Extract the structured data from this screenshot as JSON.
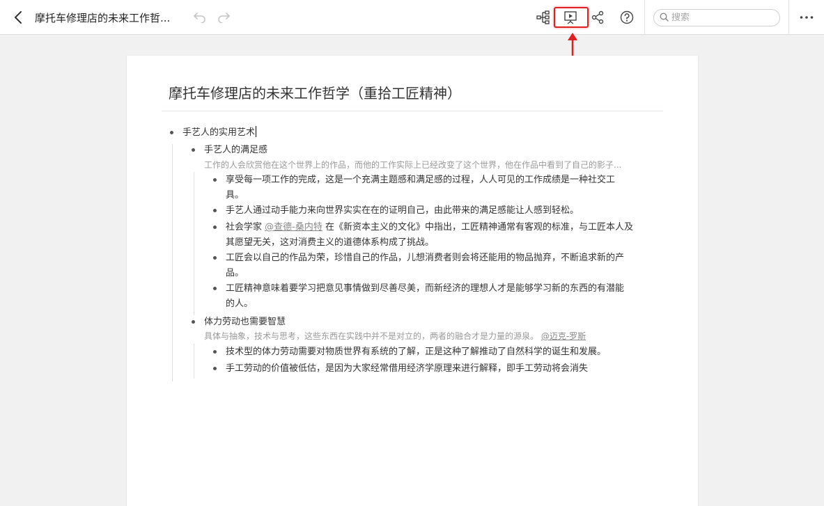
{
  "toolbar": {
    "title": "摩托车修理店的未来工作哲...",
    "search_placeholder": "搜索"
  },
  "doc": {
    "title": "摩托车修理店的未来工作哲学（重拾工匠精神）",
    "root": {
      "label": "手艺人的实用艺术"
    },
    "section1": {
      "label": "手艺人的满足感",
      "note": "工作的人会欣赏他在这个世界上的作品，而他的工作实际上已经改变了这个世界，他在作品中看到了自己的影子...",
      "items": [
        {
          "line1": "享受每一项工作的完成，这是一个充满主题感和满足感的过程，人人可见的工作成绩是一种社交工",
          "line2": "具。"
        },
        {
          "line1": "手艺人通过动手能力来向世界实实在在的证明自己，由此带来的满足感能让人感到轻松。"
        },
        {
          "pre": "社会学家 ",
          "mention": "@查德-桑内特",
          "post": " 在《新资本主义的文化》中指出，工匠精神通常有客观的标准，与工匠本人及",
          "line2": "其愿望无关，这对消费主义的道德体系构成了挑战。"
        },
        {
          "line1": "工匠会以自己的作品为荣，珍惜自己的作品，儿想消费者则会将还能用的物品抛弃，不断追求新的产",
          "line2": "品。"
        },
        {
          "line1": "工匠精神意味着要学习把意见事情做到尽善尽美，而新经济的理想人才是能够学习新的东西的有潜能",
          "line2": "的人。"
        }
      ]
    },
    "section2": {
      "label": "体力劳动也需要智慧",
      "note": "具体与抽象，技术与思考，这些东西在实践中并不是对立的，两者的融合才是力量的源泉。",
      "note_mention": "@迈克-罗斯",
      "items": [
        {
          "line1": "技术型的体力劳动需要对物质世界有系统的了解，正是这种了解推动了自然科学的诞生和发展。"
        },
        {
          "line1": "手工劳动的价值被低估，是因为大家经常借用经济学原理来进行解释，即手工劳动将会消失"
        }
      ]
    }
  },
  "icons": [
    "back-arrow-icon",
    "undo-icon",
    "redo-icon",
    "mindmap-icon",
    "presentation-icon",
    "share-icon",
    "help-icon",
    "search-icon",
    "more-icon"
  ],
  "colors": {
    "highlight": "#e02020",
    "note_text": "#999999",
    "background": "#f1f1f1"
  }
}
